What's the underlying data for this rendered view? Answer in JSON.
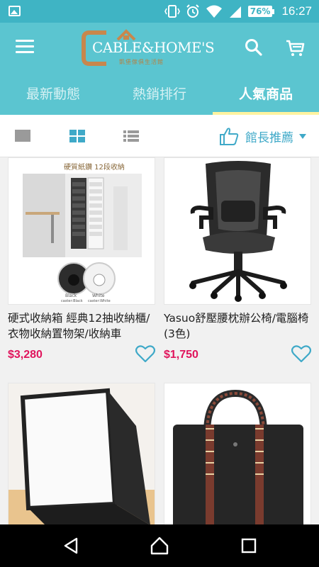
{
  "status_bar": {
    "battery": "76%",
    "time": "16:27"
  },
  "app_bar": {
    "logo_text": "CABLE&HOME'S",
    "logo_subtitle": "凱堡傢俱生活館"
  },
  "tabs": [
    {
      "label": "最新動態",
      "active": false
    },
    {
      "label": "熱銷排行",
      "active": false
    },
    {
      "label": "人氣商品",
      "active": true
    }
  ],
  "view_bar": {
    "sort_label": "館長推薦"
  },
  "products": [
    {
      "title": "硬式收納箱 經典12抽收納櫃/衣物收納置物架/收納車",
      "price": "$3,280",
      "image_caption": "硬質紙鑽 12段收納",
      "image_labels": [
        "Black",
        "caster:Black",
        "White",
        "caster:White"
      ]
    },
    {
      "title": "Yasuo舒壓腰枕辦公椅/電腦椅(3色)",
      "price": "$1,750"
    },
    {
      "title": "",
      "price": ""
    },
    {
      "title": "",
      "price": ""
    }
  ],
  "colors": {
    "accent": "#5bc5d0",
    "price": "#e0145c",
    "link": "#3fa9c8"
  }
}
